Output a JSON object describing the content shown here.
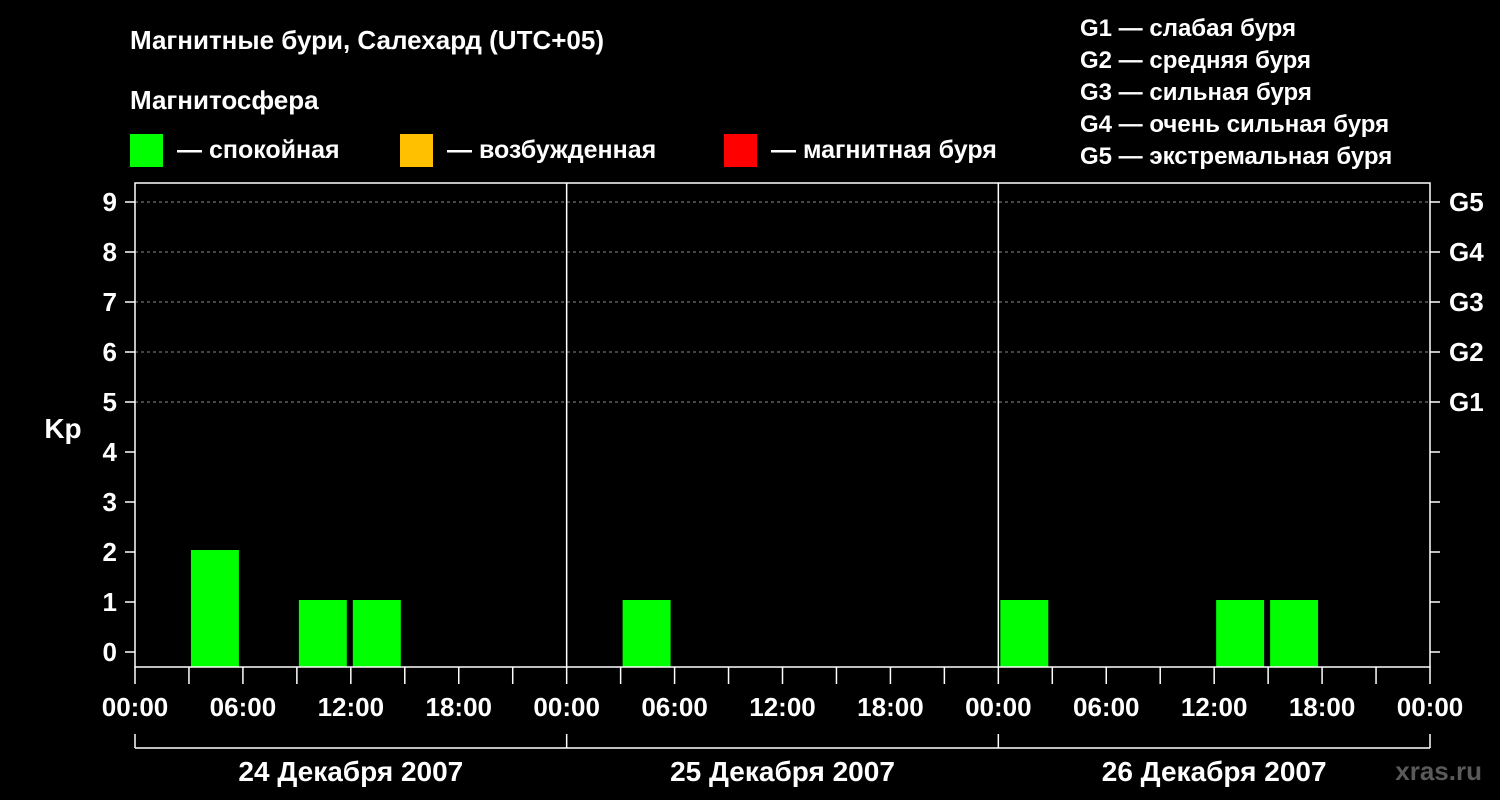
{
  "title": "Магнитные бури, Салехард (UTC+05)",
  "legend": {
    "heading": "Магнитосфера",
    "items": [
      {
        "label": "— спокойная",
        "color": "#00ff00"
      },
      {
        "label": "— возбужденная",
        "color": "#ffc000"
      },
      {
        "label": "— магнитная буря",
        "color": "#ff0000"
      }
    ]
  },
  "storm_scale": [
    "G1 — слабая буря",
    "G2 — средняя буря",
    "G3 — сильная буря",
    "G4 — очень сильная буря",
    "G5 — экстремальная буря"
  ],
  "watermark": "xras.ru",
  "chart_data": {
    "type": "bar",
    "ylabel": "Kp",
    "ylim": [
      0,
      9
    ],
    "y_ticks": [
      "0",
      "1",
      "2",
      "3",
      "4",
      "5",
      "6",
      "7",
      "8",
      "9"
    ],
    "right_axis": {
      "labels": [
        {
          "kp": 5,
          "text": "G1"
        },
        {
          "kp": 6,
          "text": "G2"
        },
        {
          "kp": 7,
          "text": "G3"
        },
        {
          "kp": 8,
          "text": "G4"
        },
        {
          "kp": 9,
          "text": "G5"
        }
      ]
    },
    "x_ticks": [
      "00:00",
      "06:00",
      "12:00",
      "18:00",
      "00:00",
      "06:00",
      "12:00",
      "18:00",
      "00:00",
      "06:00",
      "12:00",
      "18:00",
      "00:00"
    ],
    "days": [
      "24 Декабря 2007",
      "25 Декабря 2007",
      "26 Декабря 2007"
    ],
    "hours_total": 72,
    "grid_levels": [
      5,
      6,
      7,
      8,
      9
    ],
    "bars": [
      {
        "start_hour": 3,
        "kp": 2,
        "color": "#00ff00"
      },
      {
        "start_hour": 9,
        "kp": 1,
        "color": "#00ff00"
      },
      {
        "start_hour": 12,
        "kp": 1,
        "color": "#00ff00"
      },
      {
        "start_hour": 27,
        "kp": 1,
        "color": "#00ff00"
      },
      {
        "start_hour": 48,
        "kp": 1,
        "color": "#00ff00"
      },
      {
        "start_hour": 60,
        "kp": 1,
        "color": "#00ff00"
      },
      {
        "start_hour": 63,
        "kp": 1,
        "color": "#00ff00"
      }
    ]
  }
}
